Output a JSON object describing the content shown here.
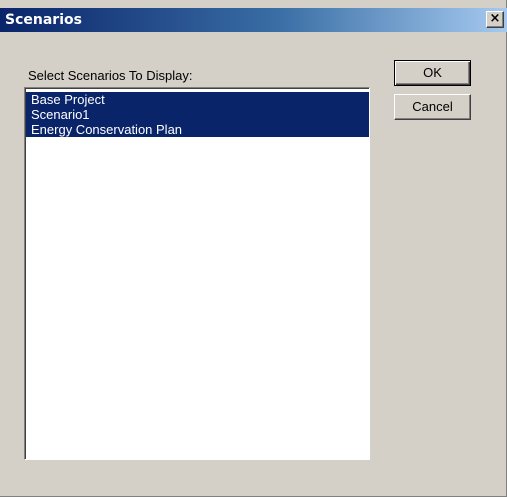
{
  "window": {
    "title": "Scenarios",
    "close_label": "×"
  },
  "dialog": {
    "select_label": "Select Scenarios To Display:",
    "scenarios": [
      {
        "label": "Base Project",
        "selected": true
      },
      {
        "label": "Scenario1",
        "selected": true
      },
      {
        "label": "Energy Conservation Plan",
        "selected": true
      }
    ]
  },
  "buttons": {
    "ok_label": "OK",
    "cancel_label": "Cancel"
  },
  "colors": {
    "selection_bg": "#0a246a",
    "dialog_bg": "#d4d0c8",
    "titlebar_start": "#0a246a",
    "titlebar_end": "#a6caf0"
  }
}
